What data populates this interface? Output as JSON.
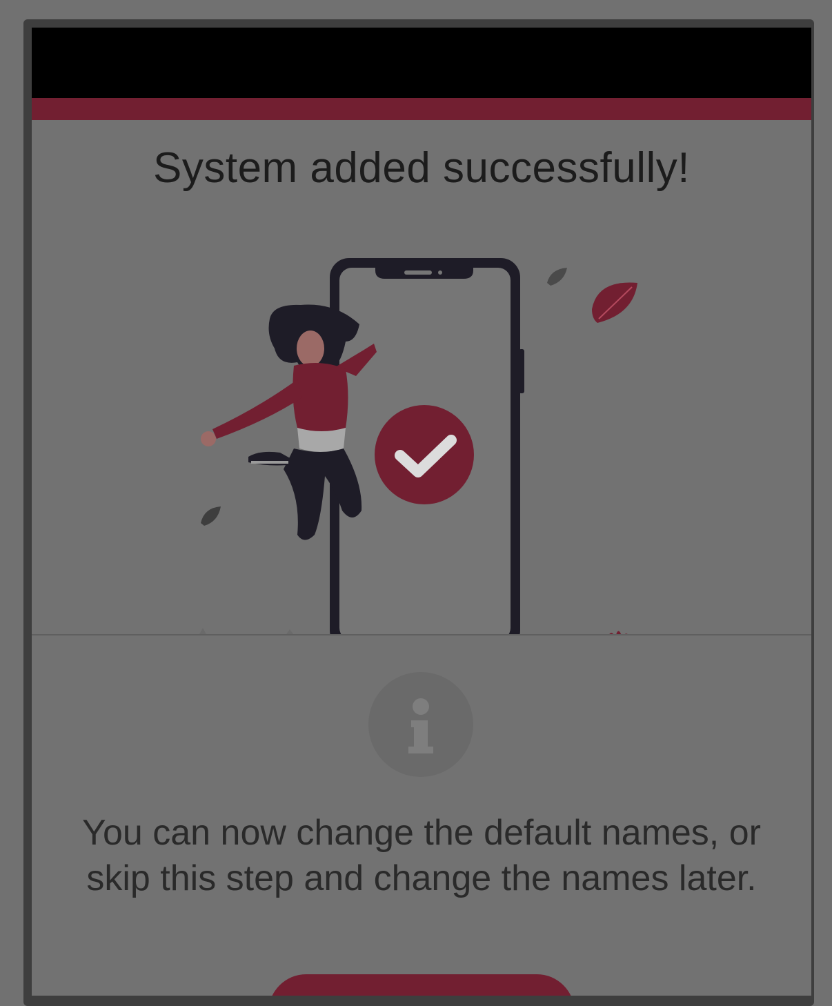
{
  "app": {
    "status_bar": "",
    "accent_color": "#721f31"
  },
  "success": {
    "title": "System added successfully!",
    "illustration_icon": "phone-checkmark-illustration"
  },
  "info": {
    "icon": "info-icon",
    "message": "You can now change the default names, or skip this step and change the names later."
  },
  "actions": {
    "primary_label": ""
  }
}
